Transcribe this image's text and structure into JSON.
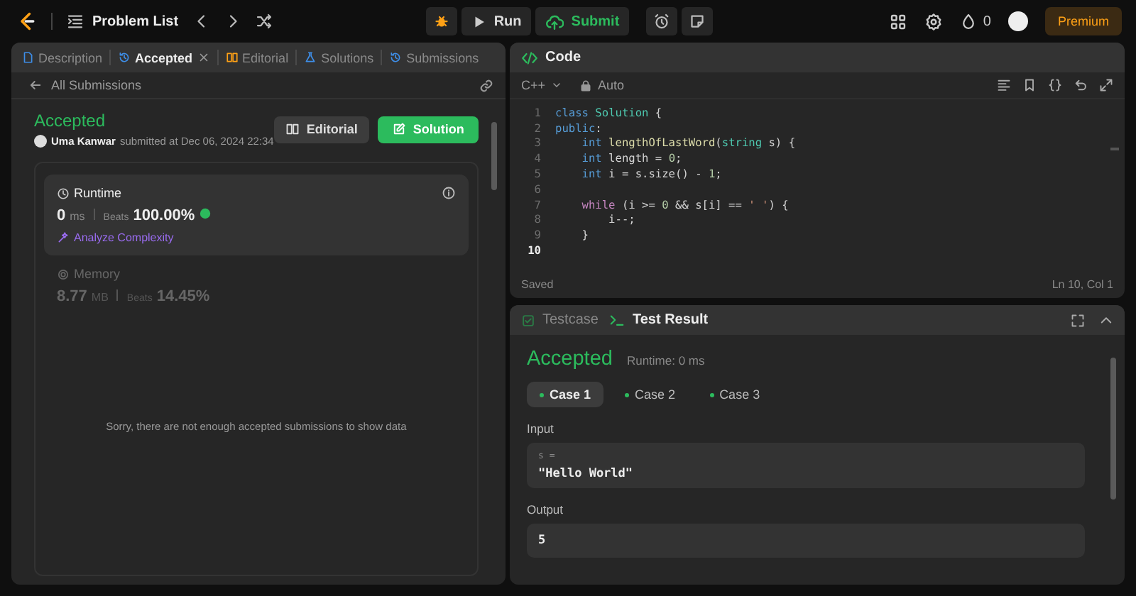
{
  "topbar": {
    "title": "Problem List",
    "run": "Run",
    "submit": "Submit",
    "streak": "0",
    "premium": "Premium"
  },
  "tabs": [
    {
      "label": "Description",
      "selected": false,
      "closable": false
    },
    {
      "label": "Accepted",
      "selected": true,
      "closable": true
    },
    {
      "label": "Editorial",
      "selected": false,
      "closable": false
    },
    {
      "label": "Solutions",
      "selected": false,
      "closable": false
    },
    {
      "label": "Submissions",
      "selected": false,
      "closable": false
    }
  ],
  "back_link": "All Submissions",
  "submission": {
    "status": "Accepted",
    "user": "Uma Kanwar",
    "submitted": "submitted at Dec 06, 2024 22:34",
    "buttons": [
      {
        "label": "Editorial",
        "kind": "secondary"
      },
      {
        "label": "Solution",
        "kind": "primary"
      }
    ]
  },
  "metrics": [
    {
      "title": "Runtime",
      "value": "0",
      "unit": "ms",
      "beats_label": "Beats",
      "beats": "100.00%",
      "selected": true,
      "analyze": "Analyze Complexity"
    },
    {
      "title": "Memory",
      "value": "8.77",
      "unit": "MB",
      "beats_label": "Beats",
      "beats": "14.45%",
      "selected": false
    }
  ],
  "empty_message": "Sorry, there are not enough accepted submissions to show data",
  "code": {
    "title": "Code",
    "language": "C++",
    "mode": "Auto",
    "status": "Saved",
    "cursor": "Ln 10, Col 1",
    "lines": [
      {
        "no": "1",
        "current": false,
        "tokens": [
          {
            "kind": "keyword",
            "text": "class"
          },
          {
            "kind": "type",
            "text": " Solution"
          },
          {
            "kind": "plain",
            "text": " {"
          }
        ]
      },
      {
        "no": "2",
        "current": false,
        "tokens": [
          {
            "kind": "keyword",
            "text": "public"
          },
          {
            "kind": "plain",
            "text": ":"
          }
        ]
      },
      {
        "no": "3",
        "current": false,
        "tokens": [
          {
            "kind": "keyword",
            "text": "    int"
          },
          {
            "kind": "function",
            "text": " lengthOfLastWord"
          },
          {
            "kind": "plain",
            "text": "("
          },
          {
            "kind": "type",
            "text": "string"
          },
          {
            "kind": "plain",
            "text": " s) {"
          }
        ]
      },
      {
        "no": "4",
        "current": false,
        "tokens": [
          {
            "kind": "keyword",
            "text": "    int"
          },
          {
            "kind": "plain",
            "text": " length = "
          },
          {
            "kind": "number",
            "text": "0"
          },
          {
            "kind": "plain",
            "text": ";"
          }
        ]
      },
      {
        "no": "5",
        "current": false,
        "tokens": [
          {
            "kind": "keyword",
            "text": "    int"
          },
          {
            "kind": "plain",
            "text": " i = s.size() - "
          },
          {
            "kind": "number",
            "text": "1"
          },
          {
            "kind": "plain",
            "text": ";"
          }
        ]
      },
      {
        "no": "6",
        "current": false
      },
      {
        "no": "7",
        "current": false,
        "tokens": [
          {
            "kind": "control",
            "text": "    while"
          },
          {
            "kind": "plain",
            "text": " (i >= "
          },
          {
            "kind": "number",
            "text": "0"
          },
          {
            "kind": "plain",
            "text": " && s[i] == "
          },
          {
            "kind": "string",
            "text": "' '"
          },
          {
            "kind": "plain",
            "text": ") {"
          }
        ]
      },
      {
        "no": "8",
        "current": false,
        "tokens": [
          {
            "kind": "plain",
            "text": "        i--;"
          }
        ]
      },
      {
        "no": "9",
        "current": false,
        "tokens": [
          {
            "kind": "plain",
            "text": "    }"
          }
        ]
      },
      {
        "no": "10",
        "current": true
      }
    ]
  },
  "result": {
    "tabs": [
      {
        "label": "Testcase",
        "selected": false
      },
      {
        "label": "Test Result",
        "selected": true
      }
    ],
    "status": "Accepted",
    "runtime": "Runtime: 0 ms",
    "cases": [
      {
        "label": "Case 1",
        "selected": true
      },
      {
        "label": "Case 2",
        "selected": false
      },
      {
        "label": "Case 3",
        "selected": false
      }
    ],
    "input_label": "Input",
    "input_name": "s =",
    "input_value": "\"Hello World\"",
    "output_label": "Output",
    "output_value": "5"
  }
}
